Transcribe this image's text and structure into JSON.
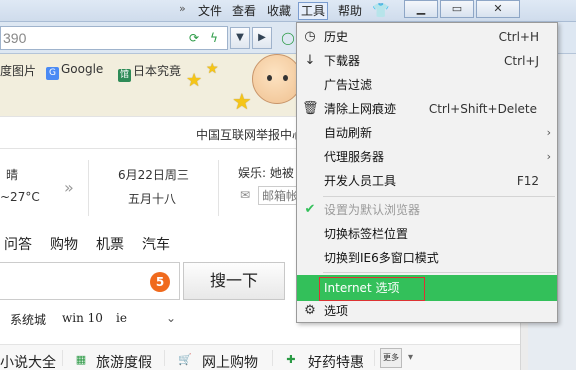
{
  "menubar": {
    "arrows": "»",
    "file": "文件",
    "view": "查看",
    "favorites": "收藏",
    "tools": "工具",
    "help": "帮助"
  },
  "address": {
    "value": "390"
  },
  "bookmarks": [
    {
      "label": "度图片",
      "icon_color": "#3b6fd6"
    },
    {
      "label": "Google",
      "icon_color": "#4a8af4"
    },
    {
      "label": "日本究竟",
      "icon_color": "#2e8b57",
      "icon_text": "馆"
    }
  ],
  "page": {
    "report_text": "中国互联网举报中心",
    "weather": {
      "condition": "晴",
      "temp": "~27°C"
    },
    "date": {
      "line1": "6月22日周三",
      "line2": "五月十八"
    },
    "entertainment": "娱乐: 她被",
    "mailbox": "邮箱帐",
    "tabs": [
      "问答",
      "购物",
      "机票",
      "汽车"
    ],
    "badge_number": "5",
    "search_button": "搜一下",
    "hot_words": [
      "系统城",
      "win 10",
      "ie"
    ],
    "categories": [
      "小说大全",
      "旅游度假",
      "网上购物",
      "好药特惠"
    ],
    "more_label": "更多"
  },
  "dropdown": {
    "items": [
      {
        "label": "历史",
        "shortcut": "Ctrl+H",
        "icon": "clock-icon",
        "state": "normal"
      },
      {
        "label": "下载器",
        "shortcut": "Ctrl+J",
        "icon": "download-arrow-icon",
        "state": "normal"
      },
      {
        "label": "广告过滤",
        "shortcut": "",
        "icon": "",
        "state": "normal"
      },
      {
        "label": "清除上网痕迹",
        "shortcut": "Ctrl+Shift+Delete",
        "icon": "trash-icon",
        "state": "normal"
      },
      {
        "label": "自动刷新",
        "shortcut": "",
        "icon": "",
        "state": "submenu"
      },
      {
        "label": "代理服务器",
        "shortcut": "",
        "icon": "",
        "state": "submenu"
      },
      {
        "label": "开发人员工具",
        "shortcut": "F12",
        "icon": "",
        "state": "normal"
      },
      {
        "label": "设置为默认浏览器",
        "shortcut": "",
        "icon": "checkmark-icon",
        "state": "disabled"
      },
      {
        "label": "切换标签栏位置",
        "shortcut": "",
        "icon": "",
        "state": "normal"
      },
      {
        "label": "切换到IE6多窗口模式",
        "shortcut": "",
        "icon": "",
        "state": "normal"
      },
      {
        "label": "Internet 选项",
        "shortcut": "",
        "icon": "",
        "state": "highlighted"
      },
      {
        "label": "选项",
        "shortcut": "",
        "icon": "gear-icon",
        "state": "normal"
      }
    ]
  },
  "colors": {
    "highlight": "#33c05a",
    "focus_outline": "#dd3333",
    "badge": "#f06a1d"
  }
}
